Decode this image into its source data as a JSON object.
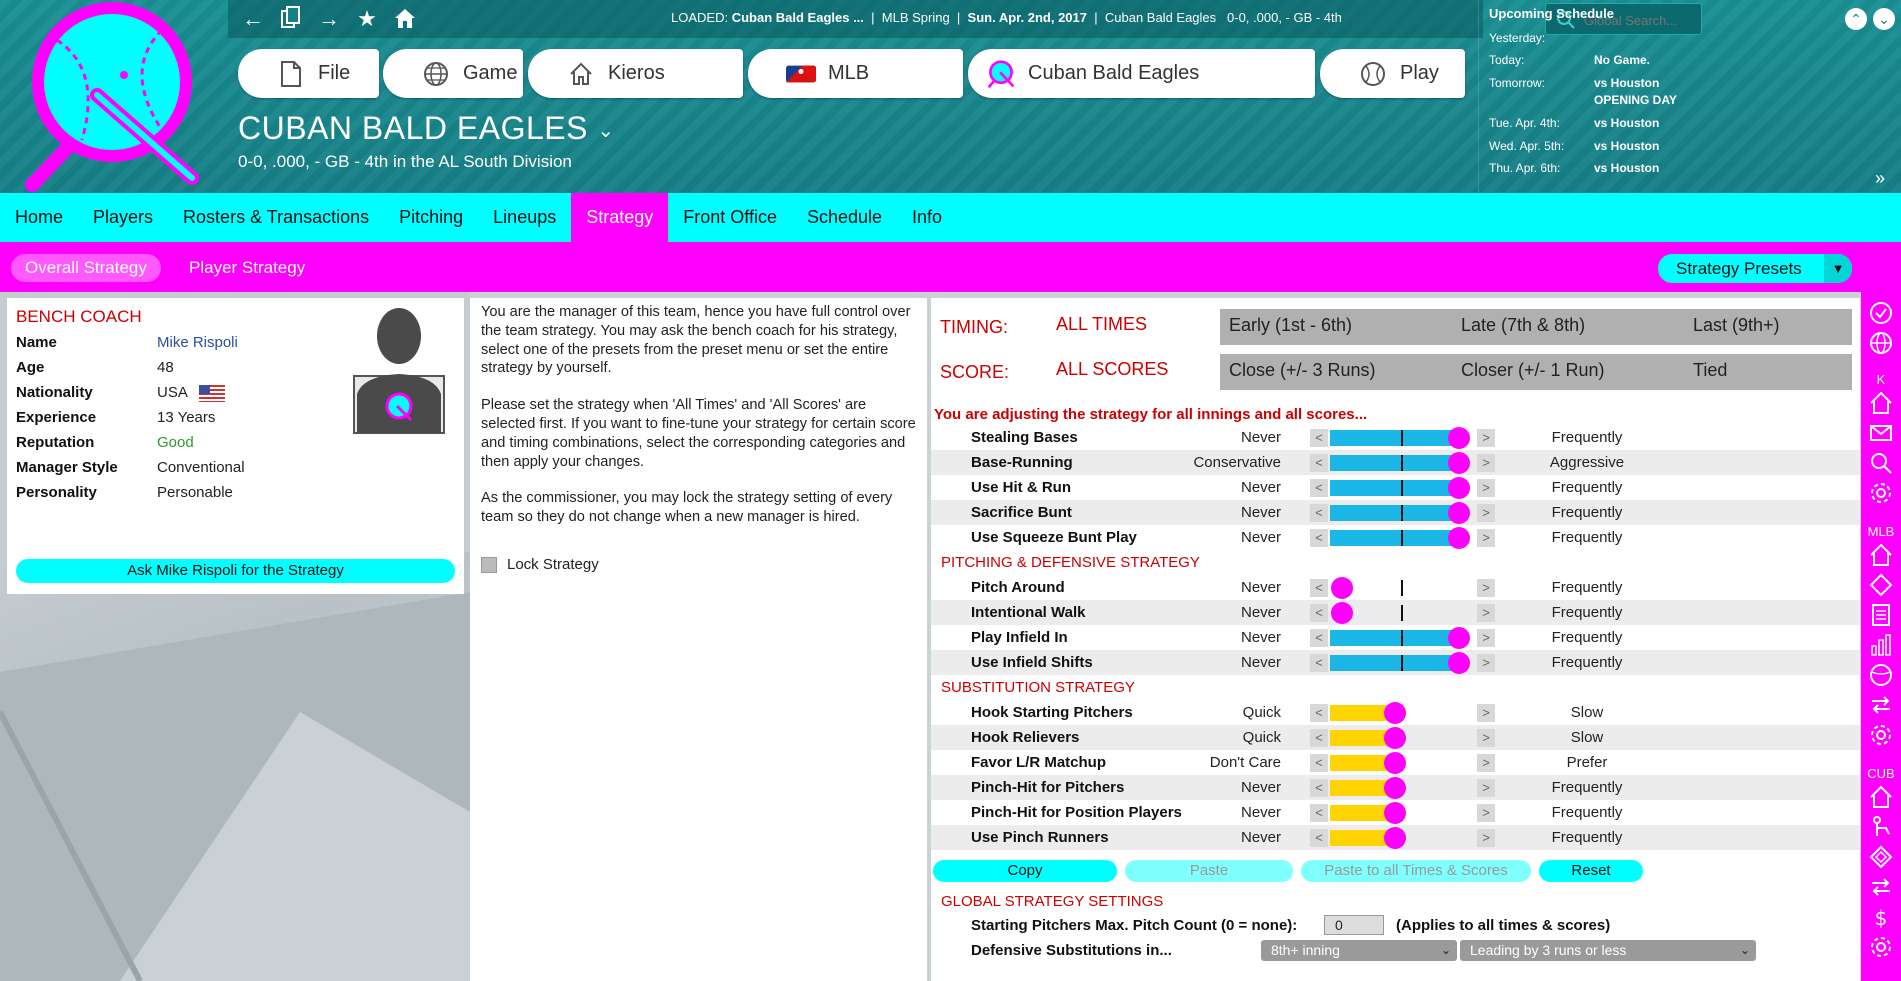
{
  "topbar": {
    "loaded_label": "LOADED:",
    "loaded_team": "Cuban Bald Eagles ...",
    "sep1": "|",
    "league": "MLB Spring",
    "sep2": "|",
    "date": "Sun. Apr. 2nd, 2017",
    "sep3": "|",
    "team_short": "Cuban Bald Eagles",
    "record": "0-0, .000, - GB - 4th",
    "search_placeholder": "Global Search..."
  },
  "menu": {
    "file": "File",
    "game": "Game",
    "kieros": "Kieros",
    "mlb": "MLB",
    "team": "Cuban Bald Eagles",
    "play": "Play"
  },
  "team": {
    "name": "CUBAN BALD EAGLES",
    "subtitle": "0-0, .000, - GB - 4th in the AL South Division"
  },
  "schedule": {
    "title": "Upcoming Schedule",
    "rows": [
      {
        "day": "Yesterday:",
        "val": ""
      },
      {
        "day": "Today:",
        "val": "No Game."
      },
      {
        "day": "Tomorrow:",
        "val": "vs Houston"
      },
      {
        "day": "",
        "val": "OPENING DAY"
      },
      {
        "day": "Tue. Apr. 4th:",
        "val": "vs Houston"
      },
      {
        "day": "Wed. Apr. 5th:",
        "val": "vs Houston"
      },
      {
        "day": "Thu. Apr. 6th:",
        "val": "vs Houston"
      }
    ]
  },
  "nav": [
    "Home",
    "Players",
    "Rosters & Transactions",
    "Pitching",
    "Lineups",
    "Strategy",
    "Front Office",
    "Schedule",
    "Info"
  ],
  "subnav": {
    "overall": "Overall Strategy",
    "player": "Player Strategy",
    "presets": "Strategy Presets"
  },
  "coach": {
    "header": "BENCH COACH",
    "fields": [
      {
        "k": "Name",
        "v": "Mike Rispoli"
      },
      {
        "k": "Age",
        "v": "48"
      },
      {
        "k": "Nationality",
        "v": "USA"
      },
      {
        "k": "Experience",
        "v": "13 Years"
      },
      {
        "k": "Reputation",
        "v": "Good"
      },
      {
        "k": "Manager Style",
        "v": "Conventional"
      },
      {
        "k": "Personality",
        "v": "Personable"
      }
    ],
    "ask_button": "Ask Mike Rispoli for the Strategy",
    "colors": {
      "name": "#2a4fa0",
      "good": "#2a9a2a"
    }
  },
  "info": {
    "p1": "You are the manager of this team, hence you have full control over the team strategy. You may ask the bench coach for his strategy, select one of the presets from the preset menu or set the entire strategy by yourself.",
    "p2": "Please set the strategy when 'All Times' and 'All Scores' are selected first. If you want to fine-tune your strategy for certain score and timing combinations, select the corresponding categories and then apply your changes.",
    "p3": "As the commissioner, you may lock the strategy setting of every team so they do not change when a new manager is hired.",
    "lock": "Lock Strategy"
  },
  "strategy": {
    "timing_label": "TIMING:",
    "timing_all": "ALL TIMES",
    "timing_opts": [
      "Early (1st - 6th)",
      "Late (7th & 8th)",
      "Last (9th+)"
    ],
    "score_label": "SCORE:",
    "score_all": "ALL SCORES",
    "score_opts": [
      "Close (+/- 3 Runs)",
      "Closer (+/- 1 Run)",
      "Tied"
    ],
    "adjusting_msg": "You are adjusting the strategy for all innings and all scores...",
    "sections": [
      {
        "title": "",
        "rows": [
          {
            "name": "Stealing Bases",
            "lo": "Never",
            "hi": "Frequently",
            "level": 1.0,
            "color": "#1ab6e6"
          },
          {
            "name": "Base-Running",
            "lo": "Conservative",
            "hi": "Aggressive",
            "level": 1.0,
            "color": "#1ab6e6"
          },
          {
            "name": "Use Hit & Run",
            "lo": "Never",
            "hi": "Frequently",
            "level": 1.0,
            "color": "#1ab6e6"
          },
          {
            "name": "Sacrifice Bunt",
            "lo": "Never",
            "hi": "Frequently",
            "level": 1.0,
            "color": "#1ab6e6"
          },
          {
            "name": "Use Squeeze Bunt Play",
            "lo": "Never",
            "hi": "Frequently",
            "level": 1.0,
            "color": "#1ab6e6"
          }
        ]
      },
      {
        "title": "PITCHING & DEFENSIVE STRATEGY",
        "rows": [
          {
            "name": "Pitch Around",
            "lo": "Never",
            "hi": "Frequently",
            "level": 0.0,
            "color": "#1ab6e6"
          },
          {
            "name": "Intentional Walk",
            "lo": "Never",
            "hi": "Frequently",
            "level": 0.0,
            "color": "#1ab6e6"
          },
          {
            "name": "Play Infield In",
            "lo": "Never",
            "hi": "Frequently",
            "level": 1.0,
            "color": "#1ab6e6"
          },
          {
            "name": "Use Infield Shifts",
            "lo": "Never",
            "hi": "Frequently",
            "level": 1.0,
            "color": "#1ab6e6"
          }
        ]
      },
      {
        "title": "SUBSTITUTION STRATEGY",
        "rows": [
          {
            "name": "Hook Starting Pitchers",
            "lo": "Quick",
            "hi": "Slow",
            "level": 0.5,
            "color": "#ffd400"
          },
          {
            "name": "Hook Relievers",
            "lo": "Quick",
            "hi": "Slow",
            "level": 0.5,
            "color": "#ffd400"
          },
          {
            "name": "Favor L/R Matchup",
            "lo": "Don't Care",
            "hi": "Prefer",
            "level": 0.5,
            "color": "#ffd400"
          },
          {
            "name": "Pinch-Hit for Pitchers",
            "lo": "Never",
            "hi": "Frequently",
            "level": 0.5,
            "color": "#ffd400"
          },
          {
            "name": "Pinch-Hit for Position Players",
            "lo": "Never",
            "hi": "Frequently",
            "level": 0.5,
            "color": "#ffd400"
          },
          {
            "name": "Use Pinch Runners",
            "lo": "Never",
            "hi": "Frequently",
            "level": 0.5,
            "color": "#ffd400"
          }
        ]
      }
    ],
    "buttons": {
      "copy": "Copy",
      "paste": "Paste",
      "paste_all": "Paste to all Times & Scores",
      "reset": "Reset"
    },
    "global_title": "GLOBAL STRATEGY SETTINGS",
    "pitch_count_label": "Starting Pitchers Max. Pitch Count (0 = none):",
    "pitch_count_value": "0",
    "pitch_count_note": "(Applies to all times & scores)",
    "def_sub_label": "Defensive Substitutions in...",
    "def_sub_inning": "8th+ inning",
    "def_sub_lead": "Leading by 3 runs or less"
  },
  "sidebar": {
    "k": "K",
    "mlb": "MLB",
    "cub": "CUB"
  },
  "colors": {
    "cyan": "#00ffff",
    "magenta": "#ff00ff",
    "teal": "#177f86",
    "red": "#cc0000"
  }
}
